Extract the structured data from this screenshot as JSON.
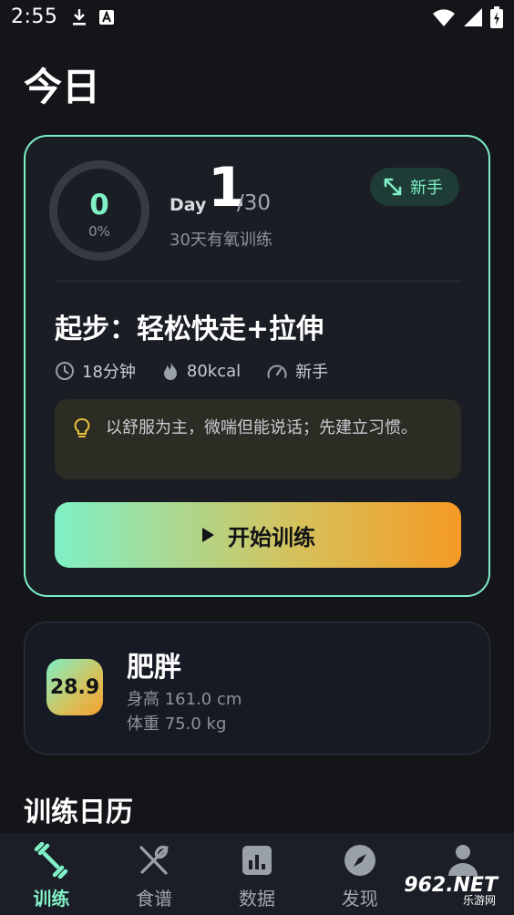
{
  "status_bar": {
    "time": "2:55"
  },
  "page": {
    "title": "今日"
  },
  "plan_card": {
    "progress_value": "0",
    "progress_percent": "0%",
    "day_label": "Day",
    "day_number": "1",
    "day_total": "/30",
    "plan_name": "30天有氧训练",
    "level_badge": "新手",
    "workout_title": "起步：轻松快走+拉伸",
    "duration": "18分钟",
    "calories": "80kcal",
    "difficulty": "新手",
    "tip": "以舒服为主，微喘但能说话；先建立习惯。",
    "start_button": "开始训练"
  },
  "bmi_card": {
    "bmi_value": "28.9",
    "category": "肥胖",
    "height": "身高 161.0 cm",
    "weight": "体重 75.0 kg"
  },
  "calendar": {
    "title": "训练日历"
  },
  "bottom_nav": {
    "items": [
      {
        "label": "训练",
        "icon": "dumbbell-icon",
        "active": true
      },
      {
        "label": "食谱",
        "icon": "fork-knife-icon",
        "active": false
      },
      {
        "label": "数据",
        "icon": "chart-icon",
        "active": false
      },
      {
        "label": "发现",
        "icon": "compass-icon",
        "active": false
      },
      {
        "label": "",
        "icon": "profile-icon",
        "active": false
      }
    ]
  },
  "watermark": {
    "brand": "962.NET",
    "sub": "乐游网"
  },
  "colors": {
    "accent": "#7ff0c6",
    "gradient_end": "#f59a24",
    "background": "#131519",
    "card": "#1a1d24"
  }
}
